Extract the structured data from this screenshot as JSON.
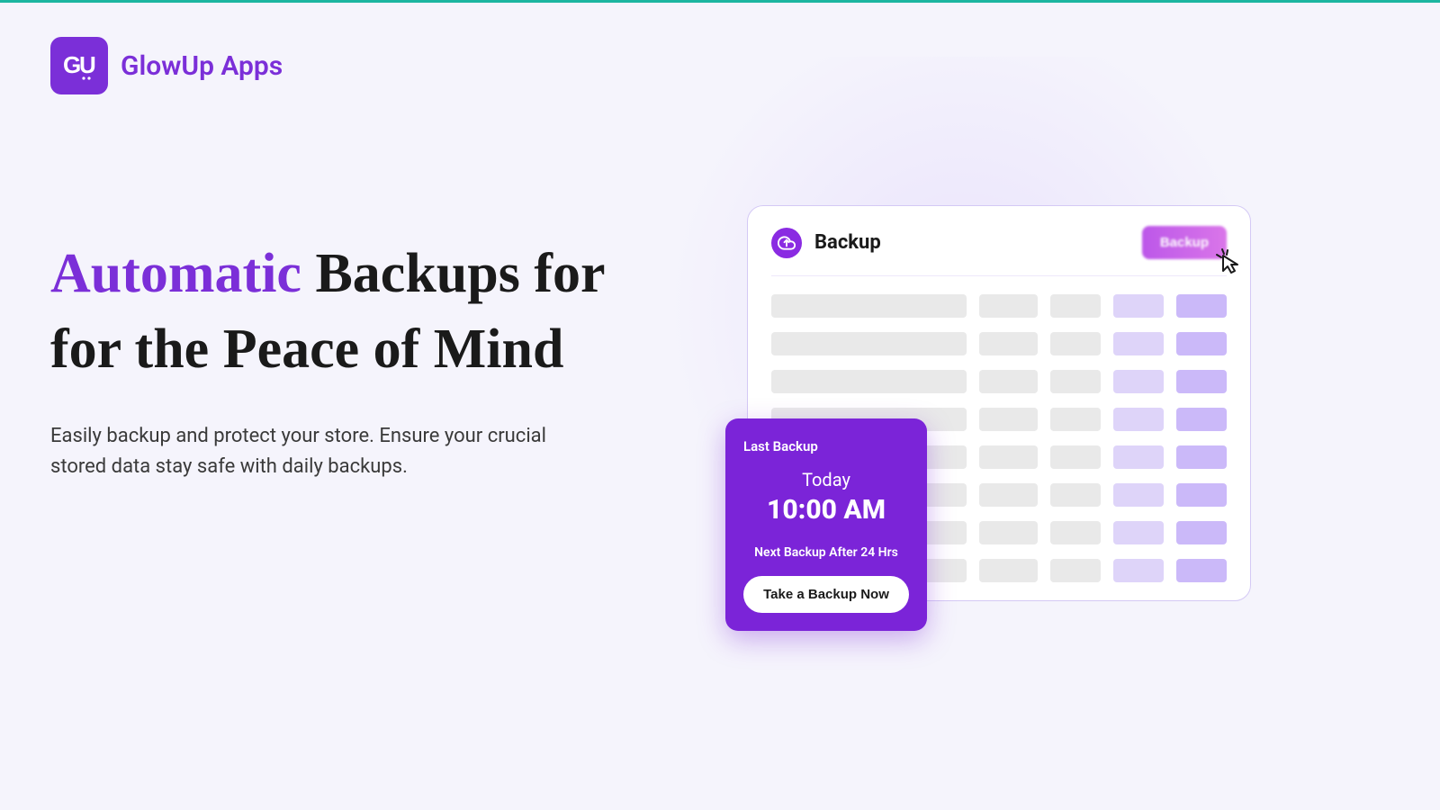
{
  "brand": {
    "name": "GlowUp Apps",
    "logo_letters": "GU"
  },
  "hero": {
    "title_accent": "Automatic",
    "title_rest": "Backups for for the Peace of Mind",
    "description": "Easily backup and protect your store. Ensure your crucial stored data stay safe with daily backups."
  },
  "panel": {
    "title": "Backup",
    "button_label": "Backup"
  },
  "last_backup": {
    "label": "Last Backup",
    "day": "Today",
    "time": "10:00 AM",
    "next": "Next Backup After 24 Hrs",
    "cta": "Take a Backup Now"
  },
  "colors": {
    "accent": "#7b2fd8",
    "accent_dark": "#7b24d8"
  }
}
